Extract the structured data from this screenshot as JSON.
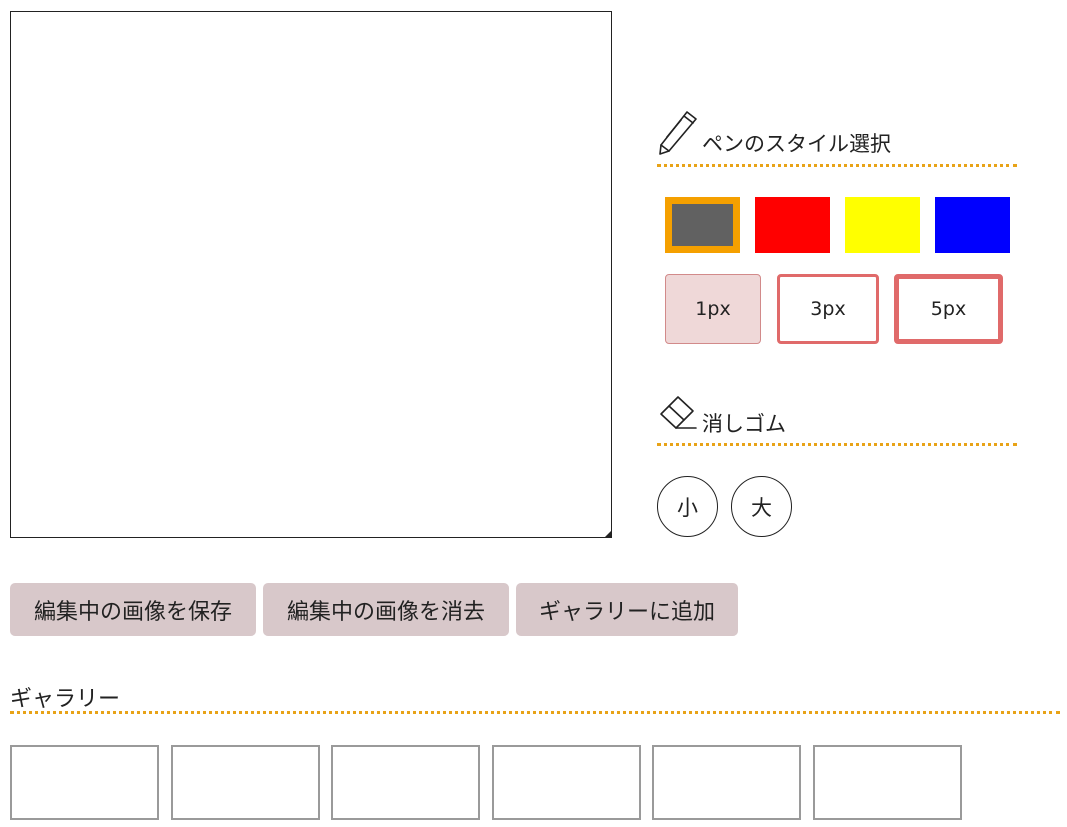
{
  "pen_section": {
    "title": "ペンのスタイル選択",
    "icon": "pencil-icon",
    "colors": [
      {
        "name": "gray",
        "hex": "#616161",
        "selected": true
      },
      {
        "name": "red",
        "hex": "#ff0000",
        "selected": false
      },
      {
        "name": "yellow",
        "hex": "#ffff00",
        "selected": false
      },
      {
        "name": "blue",
        "hex": "#0000ff",
        "selected": false
      }
    ],
    "selected_border_color": "#f5a000",
    "sizes": [
      {
        "label": "1px",
        "selected": true
      },
      {
        "label": "3px",
        "selected": false
      },
      {
        "label": "5px",
        "selected": false
      }
    ]
  },
  "eraser_section": {
    "title": "消しゴム",
    "icon": "eraser-icon",
    "sizes": [
      "小",
      "大"
    ]
  },
  "actions": {
    "save_label": "編集中の画像を保存",
    "clear_label": "編集中の画像を消去",
    "add_label": "ギャラリーに追加"
  },
  "gallery": {
    "title": "ギャラリー",
    "thumbnail_count": 6
  },
  "colors": {
    "accent_dotted": "#e8a317",
    "button_bg": "#d8c8ca",
    "size_border": "#e06a6a"
  }
}
